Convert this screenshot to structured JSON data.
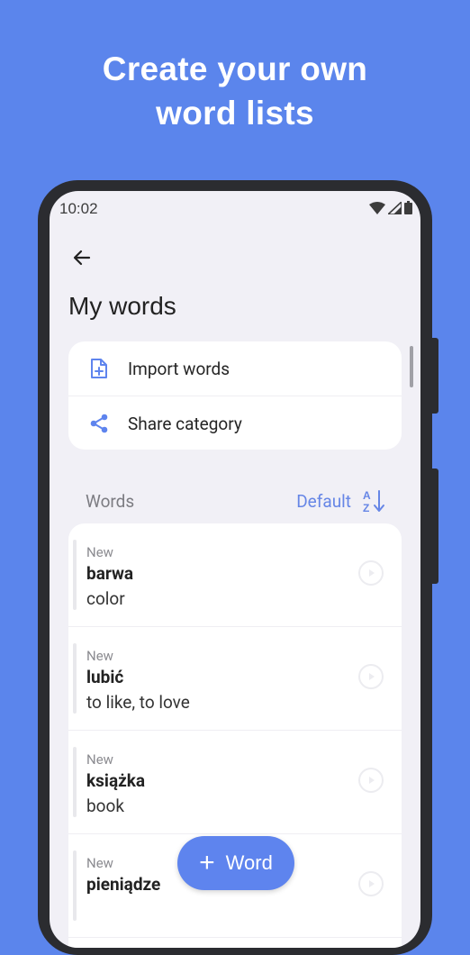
{
  "headline": {
    "line1": "Create your own",
    "line2": "word lists"
  },
  "status_bar": {
    "time": "10:02"
  },
  "page": {
    "title": "My words"
  },
  "actions": [
    {
      "icon": "file-plus-icon",
      "label": "Import words"
    },
    {
      "icon": "share-icon",
      "label": "Share category"
    }
  ],
  "words_section": {
    "label": "Words",
    "sort_label": "Default",
    "sort_icon": "sort-az-icon"
  },
  "words": [
    {
      "status": "New",
      "term": "barwa",
      "translation": "color"
    },
    {
      "status": "New",
      "term": "lubić",
      "translation": "to like, to love"
    },
    {
      "status": "New",
      "term": "książka",
      "translation": "book"
    },
    {
      "status": "New",
      "term": "pieniądze",
      "translation": ""
    }
  ],
  "fab": {
    "label": "Word",
    "icon": "plus-icon"
  },
  "colors": {
    "background": "#5b85ec",
    "accent": "#5e84ee",
    "screen": "#f1f0f6"
  }
}
